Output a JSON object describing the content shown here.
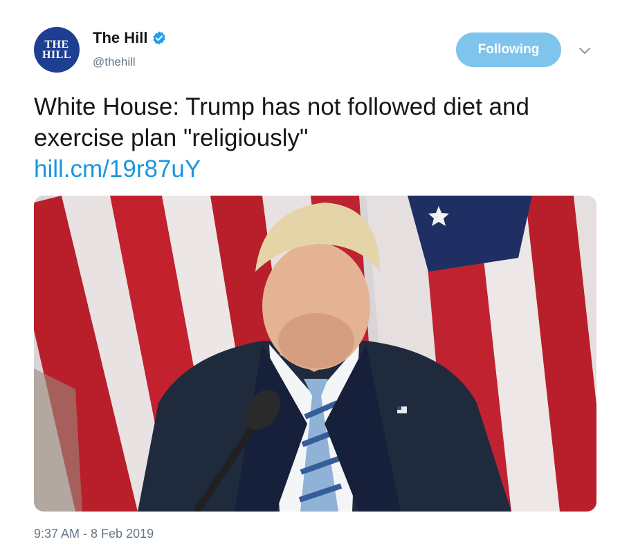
{
  "account": {
    "avatar_line1": "THE",
    "avatar_line2": "HILL",
    "display_name": "The Hill",
    "handle": "@thehill",
    "verified_icon": "verified-badge-icon",
    "brand_color": "#1e3f91"
  },
  "actions": {
    "follow_label": "Following",
    "follow_color": "#7fc4ec",
    "menu_icon": "chevron-down-icon"
  },
  "tweet": {
    "text": "White House: Trump has not followed diet and exercise plan \"religiously\"",
    "link": "hill.cm/19r87uY",
    "link_color": "#1b95e0",
    "media_icon": "photo-man-at-microphone",
    "timestamp": "9:37 AM - 8 Feb 2019"
  }
}
